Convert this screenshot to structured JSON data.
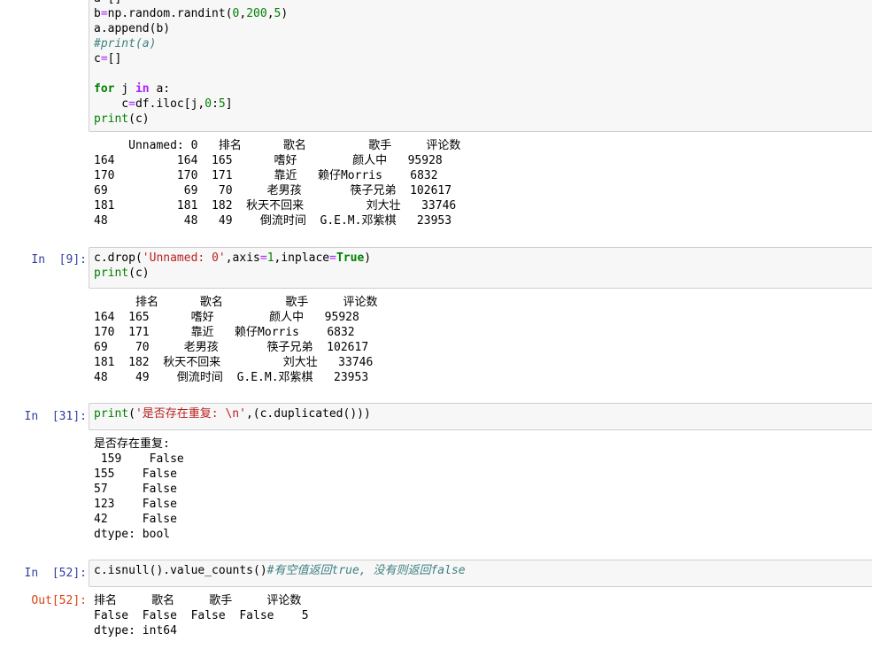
{
  "cell_a": {
    "prompt": "",
    "lines": [
      [
        {
          "t": "a=[]",
          "c": ""
        }
      ],
      [
        {
          "t": "b",
          "c": ""
        },
        {
          "t": "=",
          "c": "eq"
        },
        {
          "t": "np.random.randint(",
          "c": ""
        },
        {
          "t": "0",
          "c": "num"
        },
        {
          "t": ",",
          "c": ""
        },
        {
          "t": "200",
          "c": "num"
        },
        {
          "t": ",",
          "c": ""
        },
        {
          "t": "5",
          "c": "num"
        },
        {
          "t": ")",
          "c": ""
        }
      ],
      [
        {
          "t": "a.append(b)",
          "c": ""
        }
      ],
      [
        {
          "t": "#print(a)",
          "c": "cm"
        }
      ],
      [
        {
          "t": "c",
          "c": ""
        },
        {
          "t": "=",
          "c": "eq"
        },
        {
          "t": "[]",
          "c": ""
        }
      ],
      [
        {
          "t": "",
          "c": ""
        }
      ],
      [
        {
          "t": "for",
          "c": "kw"
        },
        {
          "t": " j ",
          "c": ""
        },
        {
          "t": "in",
          "c": "op"
        },
        {
          "t": " a:",
          "c": ""
        }
      ],
      [
        {
          "t": "    c",
          "c": ""
        },
        {
          "t": "=",
          "c": "eq"
        },
        {
          "t": "df.iloc[j,",
          "c": ""
        },
        {
          "t": "0",
          "c": "num"
        },
        {
          "t": ":",
          "c": ""
        },
        {
          "t": "5",
          "c": "num"
        },
        {
          "t": "]",
          "c": ""
        }
      ],
      [
        {
          "t": "print",
          "c": "kw-plain"
        },
        {
          "t": "(c)",
          "c": ""
        }
      ]
    ],
    "output": [
      "     Unnamed: 0   排名      歌名         歌手     评论数",
      "164         164  165      嗜好        颜人中   95928",
      "170         170  171      靠近   赖仔Morris    6832",
      "69           69   70     老男孩       筷子兄弟  102617",
      "181         181  182  秋天不回来         刘大壮   33746",
      "48           48   49    倒流时间  G.E.M.邓紫棋   23953"
    ]
  },
  "cell_9": {
    "prompt": "In  [9]:",
    "lines": [
      [
        {
          "t": "c.drop(",
          "c": ""
        },
        {
          "t": "'Unnamed: 0'",
          "c": "str"
        },
        {
          "t": ",axis",
          "c": ""
        },
        {
          "t": "=",
          "c": "eq"
        },
        {
          "t": "1",
          "c": "num"
        },
        {
          "t": ",inplace",
          "c": ""
        },
        {
          "t": "=",
          "c": "eq"
        },
        {
          "t": "True",
          "c": "kw"
        },
        {
          "t": ")",
          "c": ""
        }
      ],
      [
        {
          "t": "print",
          "c": "kw-plain"
        },
        {
          "t": "(c)",
          "c": ""
        }
      ]
    ],
    "output": [
      "      排名      歌名         歌手     评论数",
      "164  165      嗜好        颜人中   95928",
      "170  171      靠近   赖仔Morris    6832",
      "69    70     老男孩       筷子兄弟  102617",
      "181  182  秋天不回来         刘大壮   33746",
      "48    49    倒流时间  G.E.M.邓紫棋   23953"
    ]
  },
  "cell_31": {
    "prompt": "In  [31]:",
    "lines": [
      [
        {
          "t": "print",
          "c": "kw-plain"
        },
        {
          "t": "(",
          "c": ""
        },
        {
          "t": "'是否存在重复: \\n'",
          "c": "str"
        },
        {
          "t": ",(c.duplicated()))",
          "c": ""
        }
      ]
    ],
    "output": [
      "是否存在重复:",
      " 159    False",
      "155    False",
      "57     False",
      "123    False",
      "42     False",
      "dtype: bool"
    ]
  },
  "cell_52": {
    "prompt": "In  [52]:",
    "out_prompt": "Out[52]:",
    "lines": [
      [
        {
          "t": "c.isnull().value_counts()",
          "c": ""
        },
        {
          "t": "#有空值返回true, 没有则返回false",
          "c": "cm"
        }
      ]
    ],
    "output": [
      "排名     歌名     歌手     评论数",
      "False  False  False  False    5",
      "dtype: int64"
    ]
  },
  "colors": {
    "in_prompt": "#303f9f",
    "out_prompt": "#d84315",
    "keyword": "#008000",
    "string": "#ba2121",
    "comment": "#408080",
    "operator": "#aa22ff",
    "input_bg": "#f7f7f7",
    "input_border": "#cfcfcf"
  }
}
